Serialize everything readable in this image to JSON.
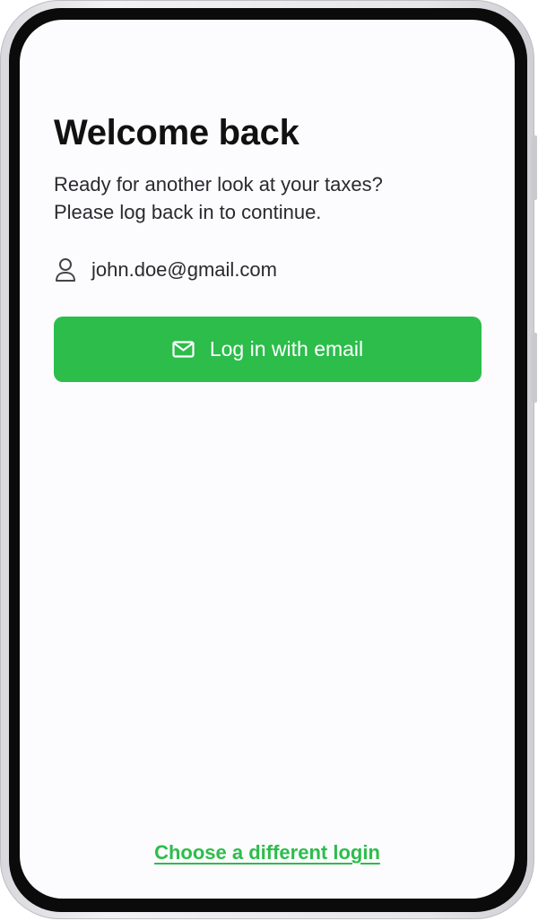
{
  "screen": {
    "title": "Welcome back",
    "subtitle_line1": "Ready for another look at your taxes?",
    "subtitle_line2": "Please log back in to continue.",
    "account": {
      "icon": "user-icon",
      "email": "john.doe@gmail.com"
    },
    "login_button": {
      "icon": "mail-icon",
      "label": "Log in with email"
    },
    "different_login_link": "Choose a different login"
  },
  "colors": {
    "accent": "#2cbd4b",
    "text": "#111111",
    "background": "#fcfbfd"
  }
}
